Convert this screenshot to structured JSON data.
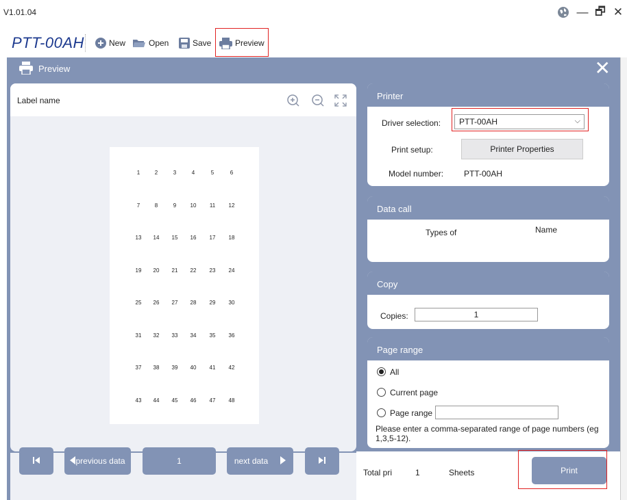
{
  "window": {
    "version": "V1.01.04",
    "minimize_glyph": "—",
    "restore_glyph": "🗗",
    "close_glyph": "✕"
  },
  "toolbar": {
    "app_name": "PTT-00AH",
    "new_label": "New",
    "open_label": "Open",
    "save_label": "Save",
    "preview_label": "Preview"
  },
  "dialog": {
    "title": "Preview",
    "close_glyph": "✕"
  },
  "preview": {
    "label_name": "Label name",
    "cells": [
      "1",
      "2",
      "3",
      "4",
      "5",
      "6",
      "7",
      "8",
      "9",
      "10",
      "11",
      "12",
      "13",
      "14",
      "15",
      "16",
      "17",
      "18",
      "19",
      "20",
      "21",
      "22",
      "23",
      "24",
      "25",
      "26",
      "27",
      "28",
      "29",
      "30",
      "31",
      "32",
      "33",
      "34",
      "35",
      "36",
      "37",
      "38",
      "39",
      "40",
      "41",
      "42",
      "43",
      "44",
      "45",
      "46",
      "47",
      "48"
    ]
  },
  "navigation": {
    "previous_label": "previous data",
    "page_value": "1",
    "next_label": "next data"
  },
  "printer": {
    "header": "Printer",
    "driver_label": "Driver selection:",
    "driver_value": "PTT-00AH",
    "setup_label": "Print setup:",
    "properties_button": "Printer Properties",
    "model_label": "Model number:",
    "model_value": "PTT-00AH"
  },
  "data_call": {
    "header": "Data call",
    "col_types": "Types of",
    "col_name": "Name"
  },
  "copy": {
    "header": "Copy",
    "copies_label": "Copies:",
    "copies_value": "1"
  },
  "page_range": {
    "header": "Page range",
    "all_label": "All",
    "current_label": "Current page",
    "range_label": "Page range",
    "range_value": "",
    "hint": "Please enter a comma-separated range of page numbers (eg 1,3,5-12)."
  },
  "footer": {
    "total_label": "Total pri",
    "total_value": "1",
    "sheets_label": "Sheets",
    "print_button": "Print"
  },
  "colors": {
    "accent": "#8293b5",
    "title_blue": "#1d3a8f",
    "highlight_red": "#e02020",
    "panel_bg": "#eef0f5"
  }
}
